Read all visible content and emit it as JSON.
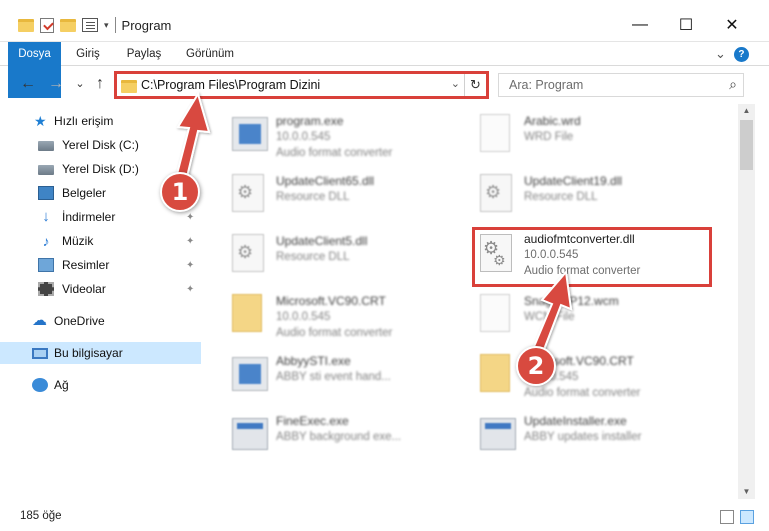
{
  "window": {
    "title": "Program",
    "minimize": "—",
    "maximize": "☐",
    "close": "✕"
  },
  "ribbon": {
    "tabs": [
      "Dosya",
      "Giriş",
      "Paylaş",
      "Görünüm"
    ],
    "expand": "⌄",
    "help": "?"
  },
  "address": {
    "back": "←",
    "forward": "→",
    "recent": "⌄",
    "up": "↑",
    "path": "C:\\Program Files\\Program Dizini",
    "dropdown": "⌄",
    "refresh": "↻"
  },
  "search": {
    "placeholder": "Ara: Program",
    "icon": "⌕"
  },
  "nav": {
    "items": [
      {
        "label": "Hızlı erişim",
        "icon": "star-icon"
      },
      {
        "label": "Yerel Disk (C:)",
        "icon": "drive-icon"
      },
      {
        "label": "Yerel Disk (D:)",
        "icon": "drive-icon"
      },
      {
        "label": "Belgeler",
        "icon": "desktop-icon"
      },
      {
        "label": "İndirmeler",
        "icon": "download-icon"
      },
      {
        "label": "Müzik",
        "icon": "music-icon"
      },
      {
        "label": "Resimler",
        "icon": "pictures-icon"
      },
      {
        "label": "Videolar",
        "icon": "video-icon"
      },
      {
        "label": "OneDrive",
        "icon": "cloud-icon"
      },
      {
        "label": "Bu bilgisayar",
        "icon": "computer-icon"
      },
      {
        "label": "Ağ",
        "icon": "network-icon"
      }
    ],
    "pin": "📌"
  },
  "files": [
    {
      "name": "program.exe",
      "line2": "10.0.0.545",
      "line3": "Audio format converter",
      "icon": "exe-icon"
    },
    {
      "name": "Arabic.wrd",
      "line2": "WRD File",
      "line3": "",
      "icon": "document-icon"
    },
    {
      "name": "UpdateClient65.dll",
      "line2": "Resource DLL",
      "line3": "",
      "icon": "dll-icon"
    },
    {
      "name": "UpdateClient19.dll",
      "line2": "Resource DLL",
      "line3": "",
      "icon": "dll-icon"
    },
    {
      "name": "UpdateClient5.dll",
      "line2": "Resource DLL",
      "line3": "",
      "icon": "dll-icon"
    },
    {
      "name": "audiofmtconverter.dll",
      "line2": "10.0.0.545",
      "line3": "Audio format converter",
      "icon": "dll-icon"
    },
    {
      "name": "Microsoft.VC90.CRT",
      "line2": "10.0.0.545",
      "line3": "Audio format converter",
      "icon": "folder-icon"
    },
    {
      "name": "SnagitWP12.wcm",
      "line2": "WCM File",
      "line3": "",
      "icon": "document-icon"
    },
    {
      "name": "AbbyySTI.exe",
      "line2": "ABBY sti event hand...",
      "line3": "",
      "icon": "exe-icon"
    },
    {
      "name": "Microsoft.VC90.CRT",
      "line2": "10.0.0.545",
      "line3": "Audio format converter",
      "icon": "folder-icon"
    },
    {
      "name": "FineExec.exe",
      "line2": "ABBY background exe...",
      "line3": "",
      "icon": "window-icon"
    },
    {
      "name": "UpdateInstaller.exe",
      "line2": "ABBY updates installer",
      "line3": "",
      "icon": "window-icon"
    }
  ],
  "status": {
    "count": "185 öğe"
  },
  "callouts": {
    "one": "1",
    "two": "2"
  }
}
